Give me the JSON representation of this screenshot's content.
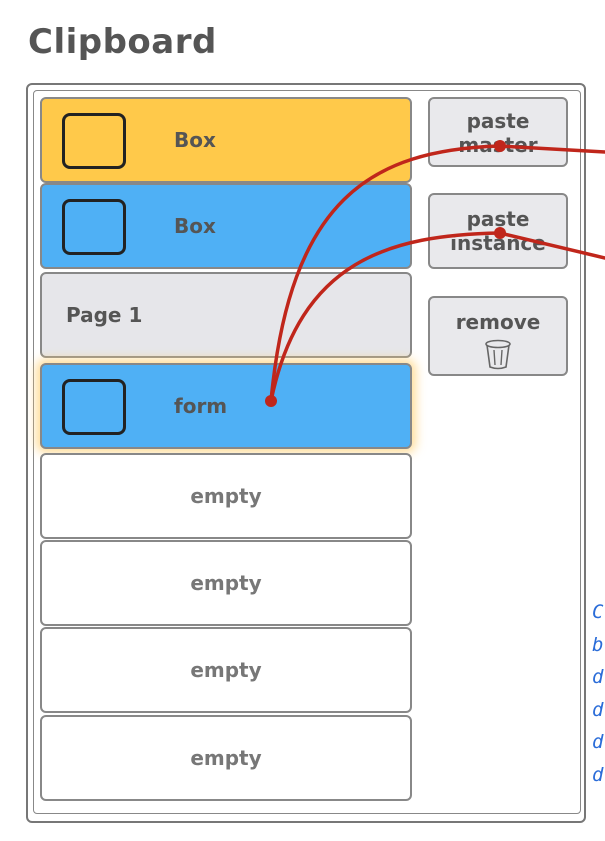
{
  "title": "Clipboard",
  "items": [
    {
      "type": "master",
      "label": "Box"
    },
    {
      "type": "instance",
      "label": "Box"
    },
    {
      "type": "page",
      "label": "Page 1"
    },
    {
      "type": "instance-selected",
      "label": "form"
    },
    {
      "type": "empty",
      "label": "empty"
    },
    {
      "type": "empty",
      "label": "empty"
    },
    {
      "type": "empty",
      "label": "empty"
    },
    {
      "type": "empty",
      "label": "empty"
    }
  ],
  "buttons": {
    "paste_master": "paste master",
    "paste_instance": "paste instance",
    "remove": "remove"
  },
  "note_lines": [
    "C",
    "b",
    "d",
    "d",
    "d",
    "d"
  ],
  "icons": {
    "remove": "trash-icon"
  },
  "colors": {
    "master": "#ffc94a",
    "instance": "#4fb0f5",
    "page": "#e6e6ea",
    "wire": "#c0261b",
    "note": "#2a6cd8"
  }
}
